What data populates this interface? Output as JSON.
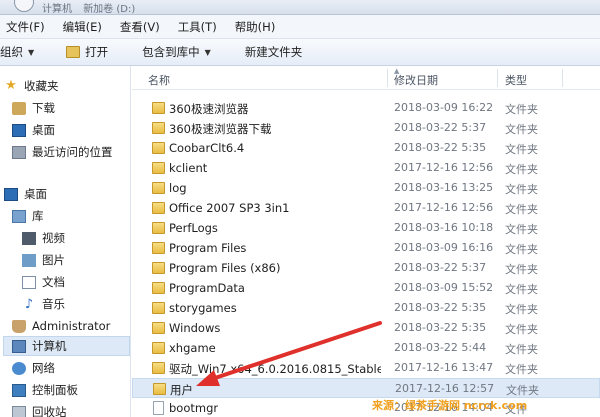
{
  "address": {
    "crumbs": [
      "计算机",
      "新加卷 (D:)"
    ]
  },
  "menu": [
    "文件(F)",
    "编辑(E)",
    "查看(V)",
    "工具(T)",
    "帮助(H)"
  ],
  "toolbar": {
    "organize": "组织",
    "open": "打开",
    "include": "包含到库中",
    "new_folder": "新建文件夹"
  },
  "nav": {
    "favorites": "收藏夹",
    "downloads": "下载",
    "desktop_fav": "桌面",
    "recent": "最近访问的位置",
    "desktop": "桌面",
    "libraries": "库",
    "video": "视频",
    "pictures": "图片",
    "documents": "文档",
    "music": "音乐",
    "admin": "Administrator",
    "computer": "计算机",
    "network": "网络",
    "control_panel": "控制面板",
    "recycle_bin": "回收站"
  },
  "columns": {
    "name": "名称",
    "date": "修改日期",
    "type": "类型"
  },
  "files": [
    {
      "name": "360极速浏览器",
      "date": "2018-03-09 16:22",
      "type": "文件夹"
    },
    {
      "name": "360极速浏览器下载",
      "date": "2018-03-22 5:37",
      "type": "文件夹"
    },
    {
      "name": "CoobarClt6.4",
      "date": "2018-03-22 5:35",
      "type": "文件夹"
    },
    {
      "name": "kclient",
      "date": "2017-12-16 12:56",
      "type": "文件夹"
    },
    {
      "name": "log",
      "date": "2018-03-16 13:25",
      "type": "文件夹"
    },
    {
      "name": "Office 2007 SP3 3in1",
      "date": "2017-12-16 12:56",
      "type": "文件夹"
    },
    {
      "name": "PerfLogs",
      "date": "2018-03-16 10:18",
      "type": "文件夹"
    },
    {
      "name": "Program Files",
      "date": "2018-03-09 16:16",
      "type": "文件夹"
    },
    {
      "name": "Program Files (x86)",
      "date": "2018-03-22 5:37",
      "type": "文件夹"
    },
    {
      "name": "ProgramData",
      "date": "2018-03-09 15:52",
      "type": "文件夹"
    },
    {
      "name": "storygames",
      "date": "2018-03-22 5:35",
      "type": "文件夹"
    },
    {
      "name": "Windows",
      "date": "2018-03-22 5:35",
      "type": "文件夹"
    },
    {
      "name": "xhgame",
      "date": "2018-03-22 5:44",
      "type": "文件夹"
    },
    {
      "name": "驱动_Win7.x64_6.0.2016.0815_Stable(...",
      "date": "2017-12-16 13:47",
      "type": "文件夹"
    },
    {
      "name": "用户",
      "date": "2017-12-16 12:57",
      "type": "文件夹"
    },
    {
      "name": "bootmgr",
      "date": "2017-12-16 14:04",
      "type": "文件"
    }
  ],
  "watermark": "来源：绿茶手游网 ncrck.com",
  "colors": {
    "selection": "#dde9f7",
    "arrow": "#e0302c",
    "watermark": "#f0a01e"
  }
}
